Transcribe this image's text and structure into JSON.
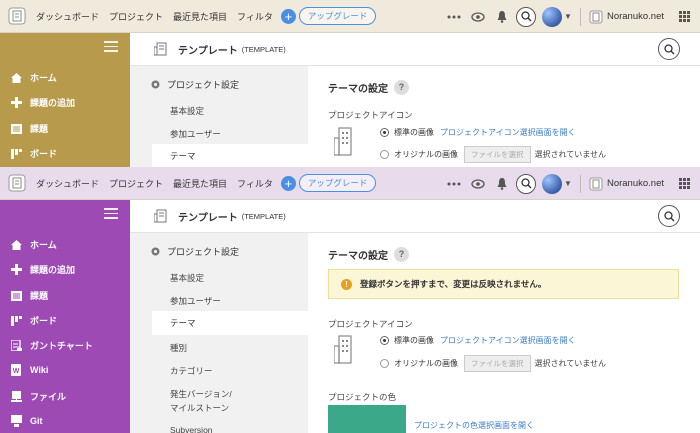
{
  "topbar": {
    "nav": [
      "ダッシュボード",
      "プロジェクト",
      "最近見た項目",
      "フィルタ"
    ],
    "add_label": "+",
    "upgrade_label": "アップグレード",
    "space_name": "Noranuko.net"
  },
  "sidebar": {
    "items": [
      {
        "label": "ホーム",
        "icon": "home-icon"
      },
      {
        "label": "課題の追加",
        "icon": "plus-icon"
      },
      {
        "label": "課題",
        "icon": "list-icon"
      },
      {
        "label": "ボード",
        "icon": "board-icon"
      },
      {
        "label": "ガントチャート",
        "icon": "gantt-icon"
      },
      {
        "label": "Wiki",
        "icon": "wiki-icon"
      },
      {
        "label": "ファイル",
        "icon": "file-icon"
      },
      {
        "label": "Git",
        "icon": "git-icon"
      }
    ],
    "colors": {
      "frame_a": "#b89a4c",
      "frame_b": "#9d4ab5"
    }
  },
  "content_head": {
    "title": "テンプレート",
    "key": "(TEMPLATE)"
  },
  "subnav": {
    "header": "プロジェクト設定",
    "items": [
      "基本設定",
      "参加ユーザー",
      "テーマ",
      "種別",
      "カテゴリー",
      "発生バージョン/",
      "マイルストーン",
      "Subversion"
    ],
    "active": "テーマ"
  },
  "main": {
    "heading": "テーマの設定",
    "help": "?",
    "notice": "登録ボタンを押すまで、変更は反映されません。",
    "icon_label": "プロジェクトアイコン",
    "option_standard": "標準の画像",
    "option_standard_link": "プロジェクトアイコン選択画面を開く",
    "option_original": "オリジナルの画像",
    "file_button": "ファイルを選択",
    "no_file": "選択されていません",
    "color_label": "プロジェクトの色",
    "color_link": "プロジェクトの色選択画面を開く",
    "project_color": "#3ba88a"
  }
}
